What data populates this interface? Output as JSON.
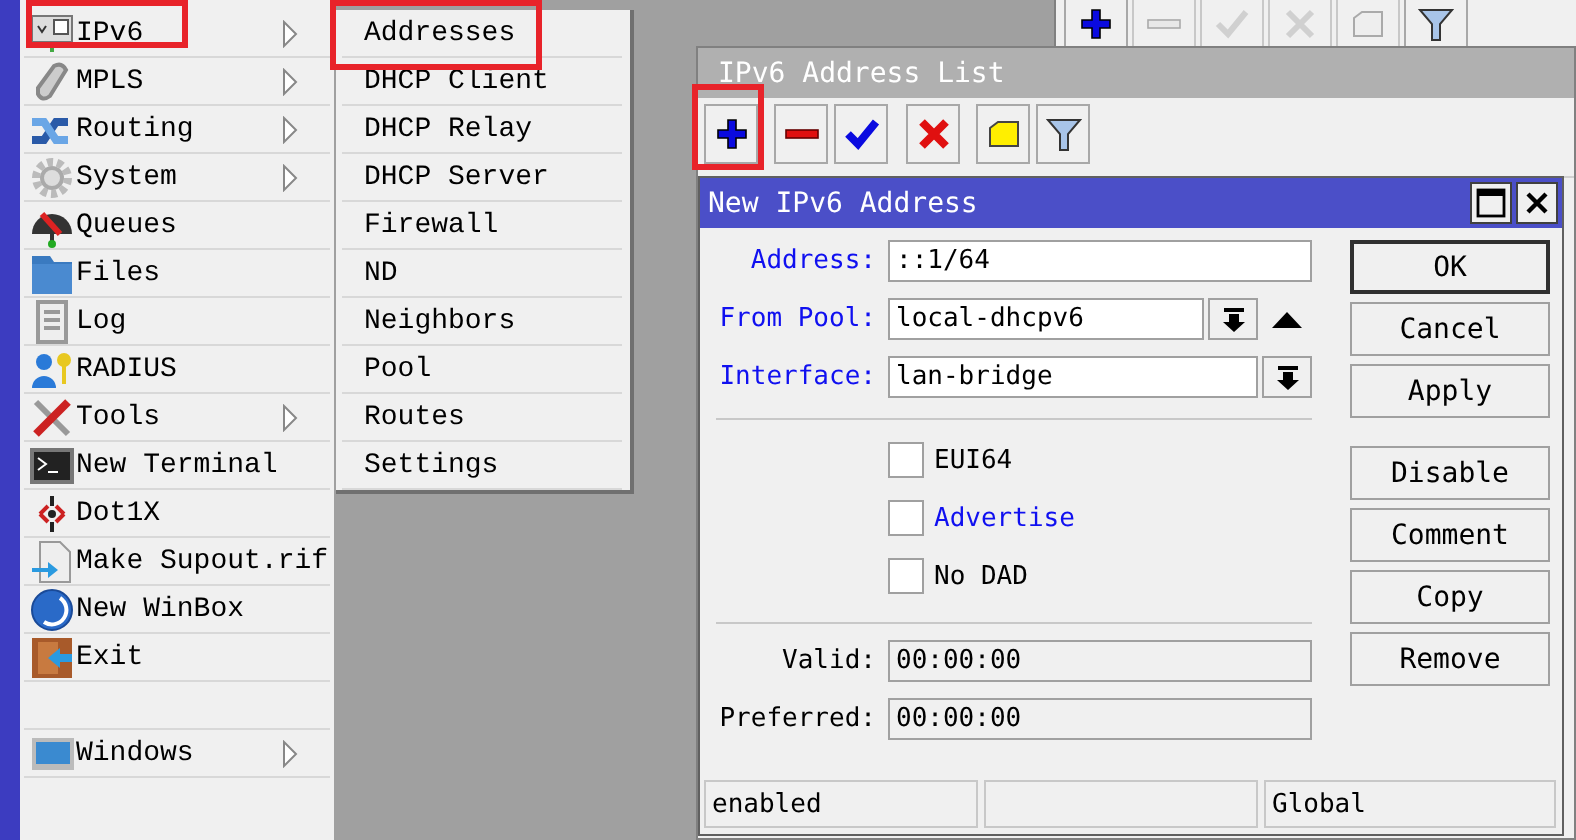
{
  "main_menu": {
    "items": [
      {
        "kind": "item",
        "label": "IPv6",
        "has_submenu": true,
        "highlighted": true
      },
      {
        "kind": "item",
        "label": "MPLS",
        "has_submenu": true,
        "highlighted": false
      },
      {
        "kind": "item",
        "label": "Routing",
        "has_submenu": true,
        "highlighted": false
      },
      {
        "kind": "item",
        "label": "System",
        "has_submenu": true,
        "highlighted": false
      },
      {
        "kind": "item",
        "label": "Queues",
        "has_submenu": false,
        "highlighted": false
      },
      {
        "kind": "item",
        "label": "Files",
        "has_submenu": false,
        "highlighted": false
      },
      {
        "kind": "item",
        "label": "Log",
        "has_submenu": false,
        "highlighted": false
      },
      {
        "kind": "item",
        "label": "RADIUS",
        "has_submenu": false,
        "highlighted": false
      },
      {
        "kind": "item",
        "label": "Tools",
        "has_submenu": true,
        "highlighted": false
      },
      {
        "kind": "item",
        "label": "New Terminal",
        "has_submenu": false,
        "highlighted": false
      },
      {
        "kind": "item",
        "label": "Dot1X",
        "has_submenu": false,
        "highlighted": false
      },
      {
        "kind": "item",
        "label": "Make Supout.rif",
        "has_submenu": false,
        "highlighted": false
      },
      {
        "kind": "item",
        "label": "New WinBox",
        "has_submenu": false,
        "highlighted": false
      },
      {
        "kind": "item",
        "label": "Exit",
        "has_submenu": false,
        "highlighted": false
      },
      {
        "kind": "spacer"
      },
      {
        "kind": "item",
        "label": "Windows",
        "has_submenu": true,
        "highlighted": false
      }
    ]
  },
  "ipv6_submenu": {
    "items": [
      {
        "label": "Addresses",
        "highlighted": true
      },
      {
        "label": "DHCP Client",
        "highlighted": false
      },
      {
        "label": "DHCP Relay",
        "highlighted": false
      },
      {
        "label": "DHCP Server",
        "highlighted": false
      },
      {
        "label": "Firewall",
        "highlighted": false
      },
      {
        "label": "ND",
        "highlighted": false
      },
      {
        "label": "Neighbors",
        "highlighted": false
      },
      {
        "label": "Pool",
        "highlighted": false
      },
      {
        "label": "Routes",
        "highlighted": false
      },
      {
        "label": "Settings",
        "highlighted": false
      }
    ]
  },
  "background_window": {
    "toolbar": [
      {
        "kind": "add",
        "disabled": false
      },
      {
        "kind": "remove",
        "disabled": true
      },
      {
        "kind": "enable",
        "disabled": true
      },
      {
        "kind": "disable",
        "disabled": true
      },
      {
        "kind": "comment",
        "disabled": true
      },
      {
        "kind": "filter",
        "disabled": false
      }
    ]
  },
  "address_list": {
    "title": "IPv6 Address List",
    "active": false,
    "toolbar": [
      {
        "kind": "add",
        "disabled": false,
        "highlighted": true
      },
      {
        "kind": "remove",
        "disabled": false,
        "highlighted": false
      },
      {
        "kind": "enable",
        "disabled": false,
        "highlighted": false
      },
      {
        "kind": "disable",
        "disabled": false,
        "highlighted": false
      },
      {
        "kind": "comment",
        "disabled": false,
        "highlighted": false
      },
      {
        "kind": "filter",
        "disabled": false,
        "highlighted": false
      }
    ]
  },
  "dialog": {
    "title": "New IPv6 Address",
    "active": true,
    "fields": [
      {
        "kind": "text",
        "label": "Address:",
        "value": "::1/64",
        "accent": true
      },
      {
        "kind": "pool",
        "label": "From Pool:",
        "value": "local-dhcpv6",
        "accent": true
      },
      {
        "kind": "dropdown",
        "label": "Interface:",
        "value": "lan-bridge",
        "accent": true
      }
    ],
    "checkboxes": [
      {
        "label": "EUI64",
        "checked": false,
        "accent": false
      },
      {
        "label": "Advertise",
        "checked": false,
        "accent": true
      },
      {
        "label": "No DAD",
        "checked": false,
        "accent": false
      }
    ],
    "timers": [
      {
        "label": "Valid:",
        "value": "00:00:00",
        "disabled": true
      },
      {
        "label": "Preferred:",
        "value": "00:00:00",
        "disabled": true
      }
    ],
    "buttons": [
      {
        "label": "OK",
        "default": true
      },
      {
        "label": "Cancel",
        "default": false
      },
      {
        "label": "Apply",
        "default": false
      }
    ],
    "item_buttons": [
      {
        "label": "Disable"
      },
      {
        "label": "Comment"
      },
      {
        "label": "Copy"
      },
      {
        "label": "Remove"
      }
    ],
    "status_bar": {
      "cell_1": "enabled",
      "cell_3": "Global"
    }
  }
}
